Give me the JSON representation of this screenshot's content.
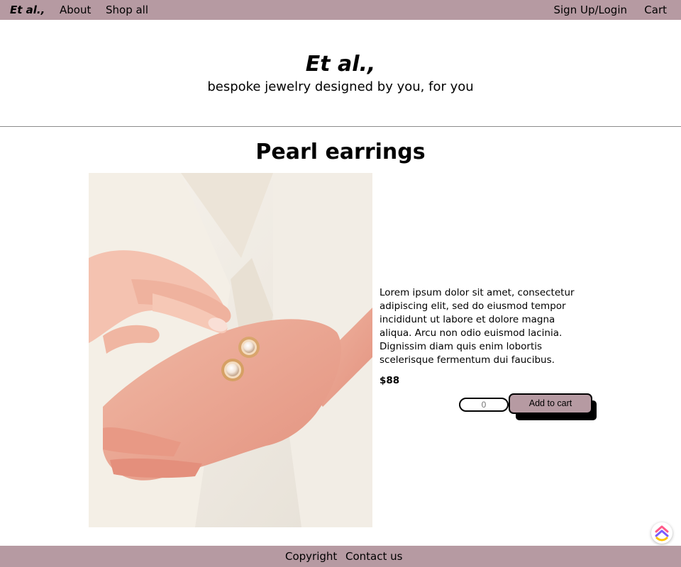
{
  "nav": {
    "brand": "Et al.,",
    "about": "About",
    "shop_all": "Shop all",
    "signup_login": "Sign Up/Login",
    "cart": "Cart"
  },
  "hero": {
    "title": "Et al.,",
    "tagline": "bespoke jewelry designed by you, for you"
  },
  "product": {
    "title": "Pearl earrings",
    "description": "Lorem ipsum dolor sit amet, consectetur adipiscing elit, sed do eiusmod tempor incididunt ut labore et dolore magna aliqua. Arcu non odio euismod lacinia. Dignissim diam quis enim lobortis scelerisque fermentum dui faucibus.",
    "price": "$88",
    "quantity_placeholder": "0",
    "add_to_cart_label": "Add to cart",
    "image_icon": "photo-hands-holding-pearl-earrings"
  },
  "footer": {
    "copyright": "Copyright",
    "contact": "Contact us"
  },
  "theme": {
    "accent": "#b69aa2",
    "divider": "#8c8c8c"
  },
  "widget": {
    "icon": "chat-widget-icon"
  }
}
